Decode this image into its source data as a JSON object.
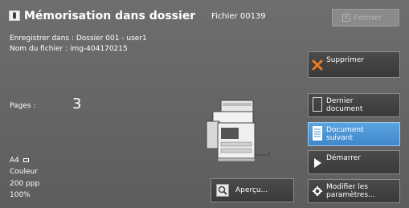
{
  "header": {
    "title": "Mémorisation dans dossier",
    "file": "Fichier 00139",
    "close_label": "Fermer"
  },
  "info": {
    "save_to": "Enregistrer dans : Dossier 001 - user1",
    "file_name": "Nom du fichier : img-404170215",
    "pages_label": "Pages :",
    "pages_value": "3",
    "paper_size": "A4",
    "color_mode": "Couleur",
    "resolution": "200 ppp",
    "scale": "100%"
  },
  "buttons": {
    "delete": "Supprimer",
    "last_document": "Dernier\ndocument",
    "next_document": "Document\nsuivant",
    "start": "Démarrer",
    "preview": "Aperçu...",
    "settings": "Modifier les\nparamètres..."
  },
  "colors": {
    "panel": "#666666",
    "accent_selected": "#4a94d4",
    "delete_icon": "#f07a1e"
  },
  "icons": {
    "header": "storage-box-icon",
    "delete": "orange-x-icon",
    "last": "document-outline-icon",
    "next": "document-lines-icon",
    "start": "play-triangle-icon",
    "preview": "magnifier-icon",
    "settings": "gear-icon"
  }
}
